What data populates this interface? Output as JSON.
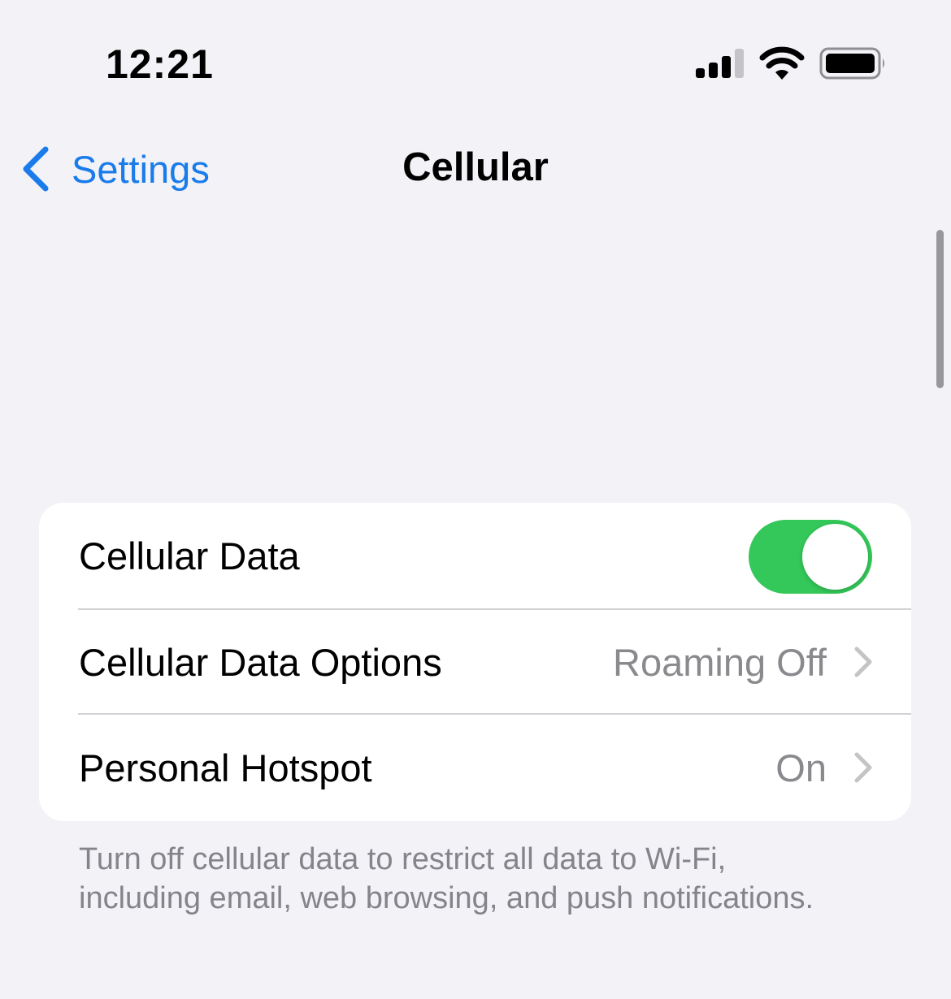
{
  "status_bar": {
    "time": "12:21",
    "icons": [
      "cellular-signal-icon",
      "wifi-icon",
      "battery-icon"
    ],
    "signal_bars_active": 3,
    "signal_bars_total": 4
  },
  "nav": {
    "back_label": "Settings",
    "title": "Cellular"
  },
  "settings_group": {
    "rows": [
      {
        "label": "Cellular Data",
        "type": "toggle",
        "on": true
      },
      {
        "label": "Cellular Data Options",
        "value": "Roaming Off",
        "type": "disclosure"
      },
      {
        "label": "Personal Hotspot",
        "value": "On",
        "type": "disclosure"
      }
    ],
    "footer": "Turn off cellular data to restrict all data to Wi-Fi, including email, web browsing, and push notifications."
  },
  "colors": {
    "accent": "#1a7bea",
    "toggle_on": "#34c759",
    "background": "#f2f2f7",
    "secondary_text": "#8a8a8e"
  }
}
